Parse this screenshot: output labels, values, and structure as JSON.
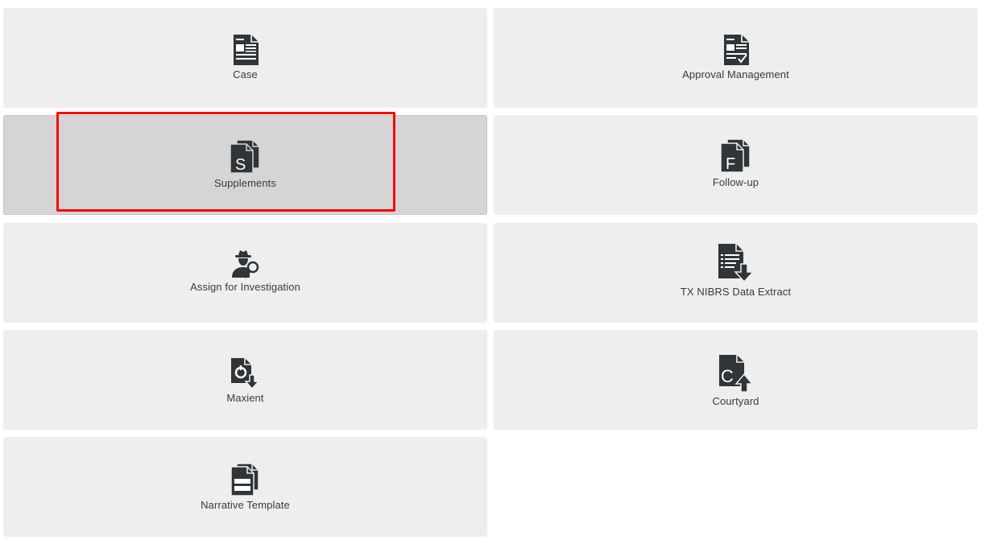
{
  "tiles": [
    {
      "label": "Case",
      "icon": "case-document-icon"
    },
    {
      "label": "Approval Management",
      "icon": "approval-document-icon"
    },
    {
      "label": "Supplements",
      "icon": "supplements-icon"
    },
    {
      "label": "Follow-up",
      "icon": "follow-up-icon"
    },
    {
      "label": "Assign for Investigation",
      "icon": "detective-search-icon"
    },
    {
      "label": "TX NIBRS Data Extract",
      "icon": "data-extract-download-icon"
    },
    {
      "label": "Maxient",
      "icon": "maxient-download-icon"
    },
    {
      "label": "Courtyard",
      "icon": "courtyard-upload-icon"
    },
    {
      "label": "Narrative Template",
      "icon": "narrative-template-icon"
    }
  ],
  "icon_letters": {
    "supplements": "S",
    "follow_up": "F",
    "courtyard": "C"
  },
  "selected_tile": "Supplements",
  "colors": {
    "tile_bg": "#eeeeee",
    "tile_active_bg": "#d5d5d5",
    "icon": "#2f3538",
    "highlight": "#ff0000"
  }
}
